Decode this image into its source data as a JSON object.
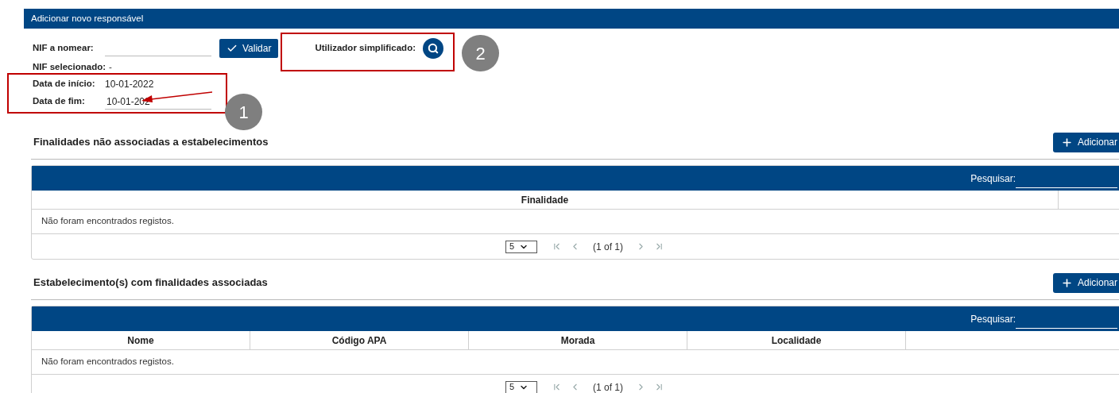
{
  "panel": {
    "title": "Adicionar novo responsável"
  },
  "form": {
    "nif_label": "NIF a nomear:",
    "validate_button": "Validar",
    "simplified_user_label": "Utilizador simplificado:",
    "nif_selected_label": "NIF selecionado:",
    "nif_selected_value": "-",
    "start_label": "Data de início:",
    "start_value": "10-01-2022",
    "end_label": "Data de fim:",
    "end_value": "10-01-202"
  },
  "annotations": [
    {
      "number": "1"
    },
    {
      "number": "2"
    }
  ],
  "sections": [
    {
      "title": "Finalidades não associadas a estabelecimentos",
      "add_button": "Adicionar",
      "search_label": "Pesquisar:",
      "columns": [
        "Finalidade"
      ],
      "empty_message": "Não foram encontrados registos.",
      "page_size": "5",
      "pager": "(1 of 1)"
    },
    {
      "title": "Estabelecimento(s) com finalidades associadas",
      "add_button": "Adicionar",
      "search_label": "Pesquisar:",
      "columns": [
        "Nome",
        "Código APA",
        "Morada",
        "Localidade"
      ],
      "empty_message": "Não foram encontrados registos.",
      "page_size": "5",
      "pager": "(1 of 1)"
    }
  ]
}
